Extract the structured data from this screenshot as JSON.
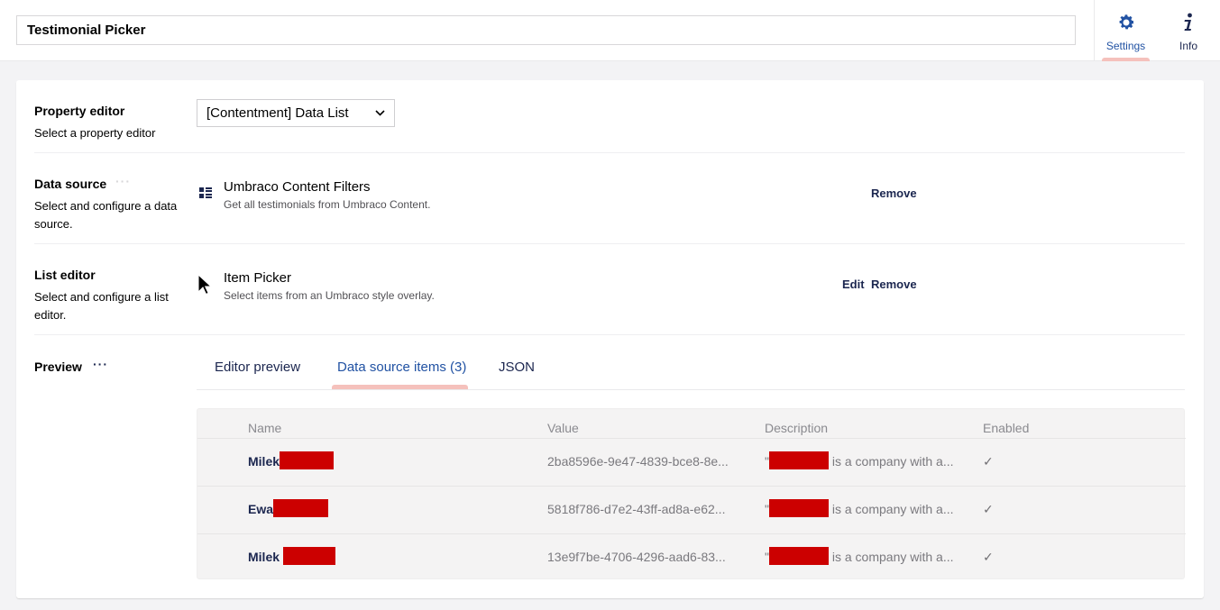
{
  "header": {
    "name_value": "Testimonial Picker",
    "apps": [
      {
        "label": "Settings",
        "icon": "gear-icon",
        "active": true
      },
      {
        "label": "Info",
        "icon": "info-icon",
        "active": false
      }
    ]
  },
  "properties": {
    "property_editor": {
      "label": "Property editor",
      "description": "Select a property editor",
      "selected": "[Contentment] Data List"
    },
    "data_source": {
      "label": "Data source",
      "description": "Select and configure a data source.",
      "item_icon": "grid-list-icon",
      "item_title": "Umbraco Content Filters",
      "item_description": "Get all testimonials from Umbraco Content.",
      "remove_label": "Remove"
    },
    "list_editor": {
      "label": "List editor",
      "description": "Select and configure a list editor.",
      "item_title": "Item Picker",
      "item_description": "Select items from an Umbraco style overlay.",
      "edit_label": "Edit",
      "remove_label": "Remove"
    },
    "preview": {
      "label": "Preview",
      "tabs": [
        {
          "label": "Editor preview",
          "active": false
        },
        {
          "label": "Data source items (3)",
          "active": true
        },
        {
          "label": "JSON",
          "active": false
        }
      ],
      "table": {
        "headers": [
          "Name",
          "Value",
          "Description",
          "Enabled"
        ],
        "rows": [
          {
            "name": "Milek",
            "value": "2ba8596e-9e47-4839-bce8-8e...",
            "desc_prefix": "\"",
            "desc_suffix": "is a company with a...",
            "enabled": "✓"
          },
          {
            "name": "Ewa",
            "value": "5818f786-d7e2-43ff-ad8a-e62...",
            "desc_prefix": "\"",
            "desc_suffix": "is a company with a...",
            "enabled": "✓"
          },
          {
            "name": "Milek",
            "value": "13e9f7be-4706-4296-aad6-83...",
            "desc_prefix": "\"",
            "desc_suffix": "is a company with a...",
            "enabled": "✓"
          }
        ]
      }
    }
  },
  "colors": {
    "accent": "#2152a3",
    "underline": "#f5c1bc",
    "redaction": "#cc0000",
    "text_dark": "#1b264f"
  }
}
